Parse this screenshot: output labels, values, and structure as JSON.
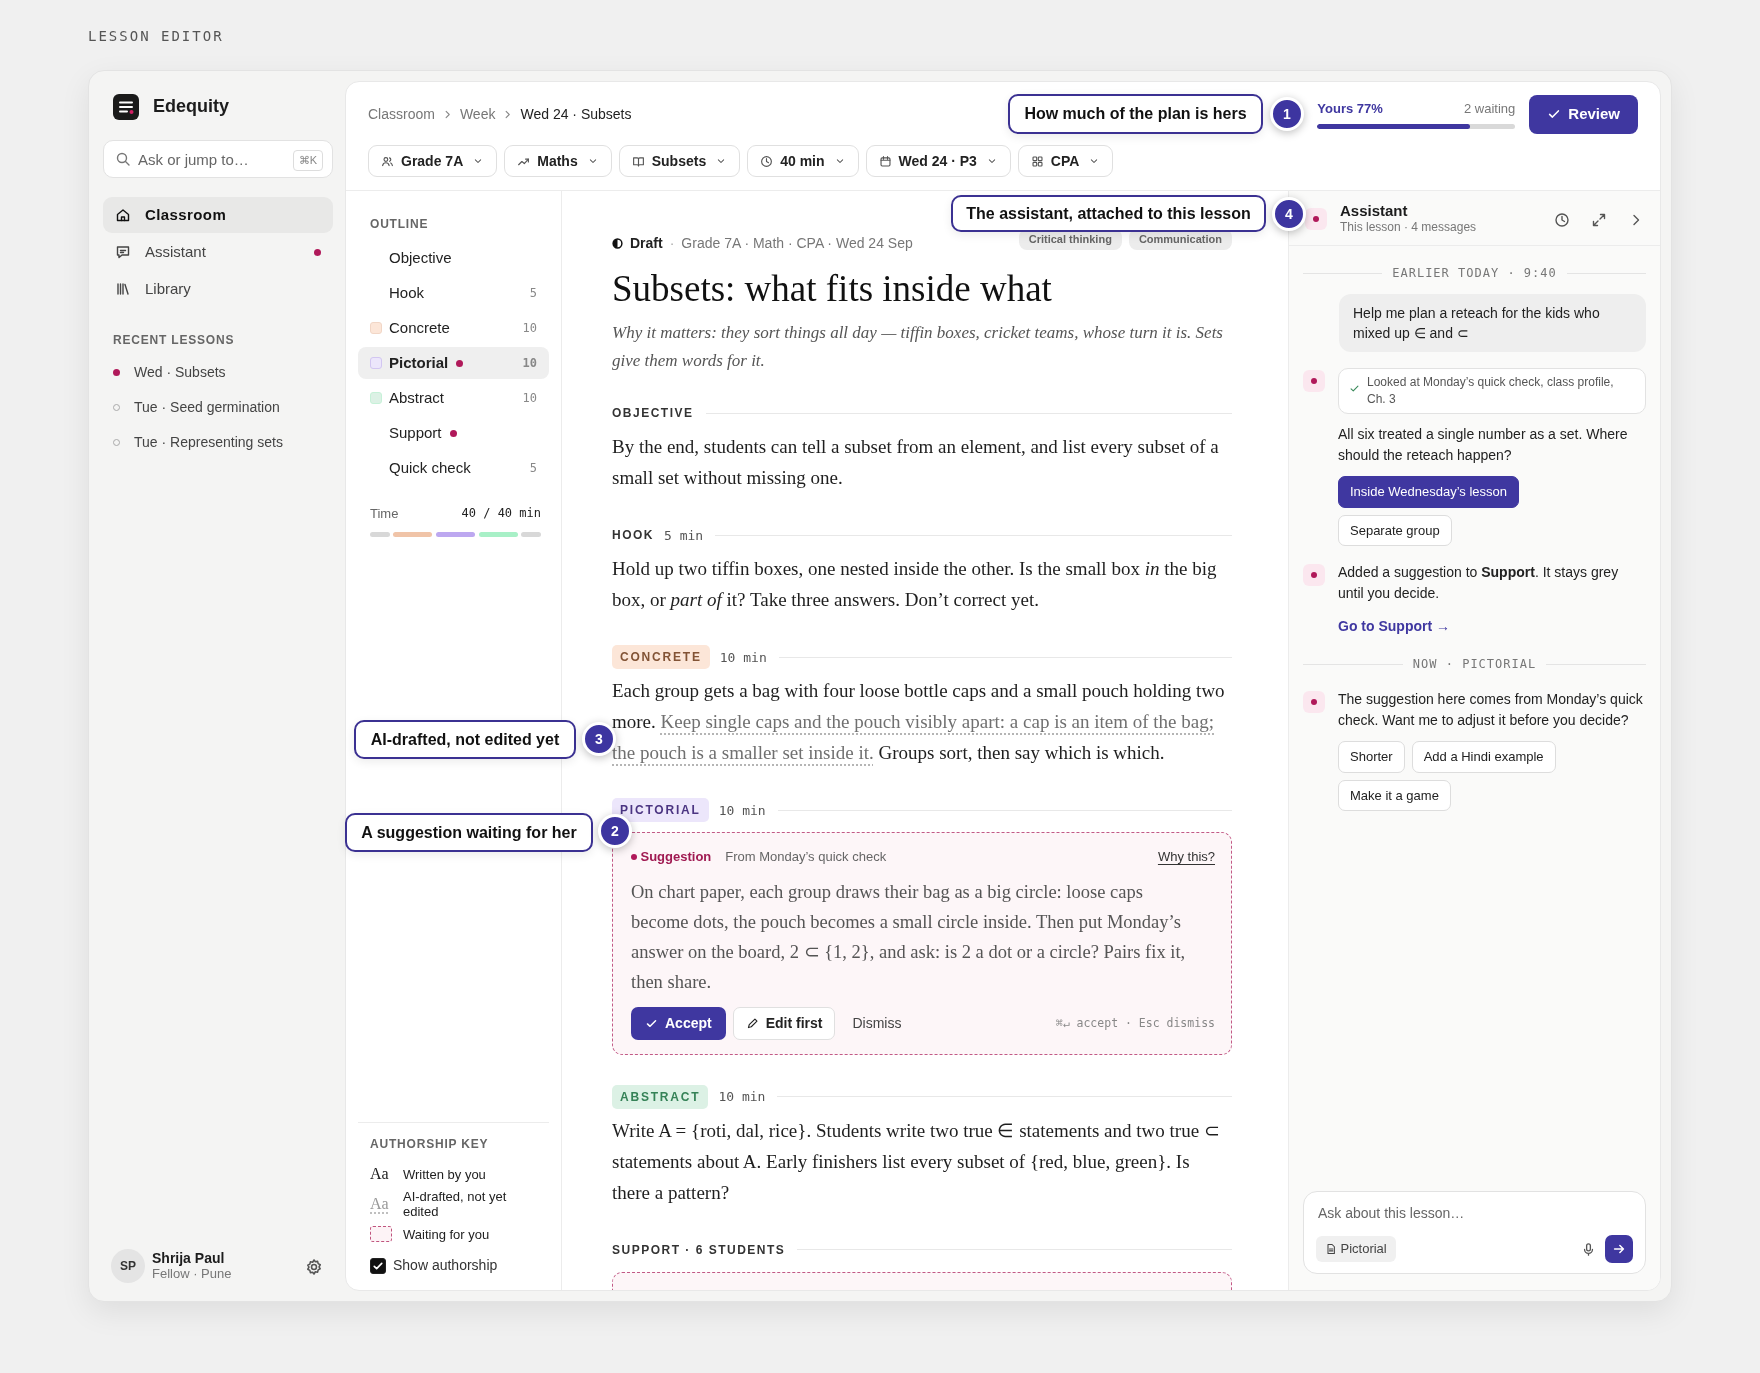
{
  "page_label": "LESSON EDITOR",
  "sidebar": {
    "brand": "Edequity",
    "search": {
      "placeholder": "Ask or jump to…",
      "shortcut": "⌘K"
    },
    "nav": [
      {
        "label": "Classroom",
        "selected": true,
        "unread": false
      },
      {
        "label": "Assistant",
        "selected": false,
        "unread": true
      },
      {
        "label": "Library",
        "selected": false,
        "unread": false
      }
    ],
    "recent_heading": "RECENT LESSONS",
    "recent": [
      {
        "label": "Wed · Subsets",
        "current": true
      },
      {
        "label": "Tue · Seed germination",
        "current": false
      },
      {
        "label": "Tue · Representing sets",
        "current": false
      }
    ],
    "user": {
      "initials": "SP",
      "name": "Shrija Paul",
      "role": "Fellow · Pune"
    }
  },
  "breadcrumb": [
    "Classroom",
    "Week",
    "Wed 24 · Subsets"
  ],
  "progress": {
    "label": "Yours 77%",
    "waiting": "2 waiting",
    "level": 0.77
  },
  "review_button": "Review",
  "filters": [
    "Grade 7A",
    "Maths",
    "Subsets",
    "40 min",
    "Wed 24 · P3",
    "CPA"
  ],
  "outline": {
    "heading": "OUTLINE",
    "items": [
      {
        "label": "Objective",
        "selected": false,
        "pending": false
      },
      {
        "label": "Hook",
        "minutes": "5",
        "selected": false,
        "pending": false
      },
      {
        "label": "Concrete",
        "minutes": "10",
        "color": "#fce6d8",
        "selected": false,
        "pending": false
      },
      {
        "label": "Pictorial",
        "minutes": "10",
        "color": "#ece6fb",
        "selected": true,
        "pending": true
      },
      {
        "label": "Abstract",
        "minutes": "10",
        "color": "#dcf1e5",
        "selected": false,
        "pending": false
      },
      {
        "label": "Support",
        "selected": false,
        "pending": true
      },
      {
        "label": "Quick check",
        "minutes": "5",
        "selected": false,
        "pending": false
      }
    ],
    "time_label": "Time",
    "time_value": "40 / 40 min"
  },
  "authorship_key": {
    "heading": "AUTHORSHIP KEY",
    "items": [
      {
        "kind": "you",
        "sample": "Aa",
        "label": "Written by you"
      },
      {
        "kind": "ai",
        "sample": "Aa",
        "label": "AI-drafted, not yet edited"
      },
      {
        "kind": "waiting",
        "label": "Waiting for you"
      }
    ],
    "toggle": {
      "label": "Show authorship",
      "checked": true
    }
  },
  "lesson": {
    "status": "Draft",
    "separator": "·",
    "meta": "Grade 7A · Math · CPA · Wed 24 Sep",
    "tags": [
      "Critical thinking",
      "Communication"
    ],
    "title": "Subsets: what fits inside what",
    "why": "Why it matters: they sort things all day — tiffin boxes, cricket teams, whose turn it is. Sets give them words for it.",
    "sections": [
      {
        "kind": "plain",
        "heading": "OBJECTIVE",
        "body": [
          {
            "text": "By the end, students can tell a subset from an element, and list every subset of a small set without missing one.",
            "ai_drafted": false
          }
        ]
      },
      {
        "kind": "plain",
        "heading": "HOOK",
        "minutes": "5 min",
        "body": [
          {
            "text": "Hold up two tiffin boxes, one nested inside the other. Is the small box *in* the big box, or *part of* it? Take three answers. Don’t correct yet.",
            "ai_drafted": false
          }
        ]
      },
      {
        "kind": "plain",
        "heading": "CONCRETE",
        "color": "#fce6d8",
        "minutes": "10 min",
        "body": [
          {
            "text": "Each group gets a bag with four loose bottle caps and a small pouch holding two more. ",
            "ai_drafted": false
          },
          {
            "text": "Keep single caps and the pouch visibly apart: a cap is an item of the bag; the pouch is a smaller set inside it.",
            "ai_drafted": true
          },
          {
            "text": " Groups sort, then say which is which.",
            "ai_drafted": false
          }
        ]
      },
      {
        "kind": "suggestion",
        "heading": "PICTORIAL",
        "color": "#ece6fb",
        "minutes": "10 min",
        "suggestion": {
          "label": "Suggestion",
          "source": "From Monday’s quick check",
          "why": "Why this?",
          "body": "On chart paper, each group draws their bag as a big circle: loose caps become dots, the pouch becomes a small circle inside. Then put Monday’s answer on the board, 2 ⊂ {1, 2}, and ask: is 2 a dot or a circle? Pairs fix it, then share.",
          "accept": "Accept",
          "edit": "Edit first",
          "dismiss": "Dismiss",
          "hint": "⌘↵ accept · Esc dismiss"
        }
      },
      {
        "kind": "plain",
        "heading": "ABSTRACT",
        "color": "#dcf1e5",
        "minutes": "10 min",
        "body": [
          {
            "text": "Write A = {roti, dal, rice}. Students write two true ∈ statements and two true ⊂ statements about A. Early finishers list every subset of {red, blue, green}. Is there a pattern?",
            "ai_drafted": false
          }
        ]
      },
      {
        "kind": "waiting",
        "heading": "SUPPORT · 6 STUDENTS"
      }
    ]
  },
  "assistant": {
    "title": "Assistant",
    "subtitle": "This lesson · 4 messages",
    "thread": [
      {
        "kind": "divider",
        "text": "EARLIER TODAY · 9:40"
      },
      {
        "kind": "user",
        "text": "Help me plan a reteach for the kids who mixed up ∈ and ⊂"
      },
      {
        "kind": "ai",
        "tool": "Looked at Monday’s quick check, class profile, Ch. 3",
        "text": "All six treated a single number as a set. Where should the reteach happen?",
        "options": [
          {
            "label": "Inside Wednesday’s lesson",
            "selected": true
          },
          {
            "label": "Separate group",
            "selected": false
          }
        ]
      },
      {
        "kind": "ai",
        "text": "Added a suggestion to **Support**. It stays grey until you decide.",
        "link": "Go to Support →"
      },
      {
        "kind": "divider",
        "text": "NOW · PICTORIAL"
      },
      {
        "kind": "ai",
        "text": "The suggestion here comes from Monday’s quick check. Want me to adjust it before you decide?",
        "options": [
          {
            "label": "Shorter",
            "selected": false
          },
          {
            "label": "Add a Hindi example",
            "selected": false
          },
          {
            "label": "Make it a game",
            "selected": false
          }
        ]
      }
    ],
    "composer": {
      "placeholder": "Ask about this lesson…",
      "context": "Pictorial"
    }
  },
  "callouts": [
    {
      "number": "1",
      "text": "How much of the plan is hers"
    },
    {
      "number": "4",
      "text": "The assistant, attached to this lesson"
    },
    {
      "number": "3",
      "text": "AI-drafted, not edited yet"
    },
    {
      "number": "2",
      "text": "A suggestion waiting for her"
    }
  ]
}
